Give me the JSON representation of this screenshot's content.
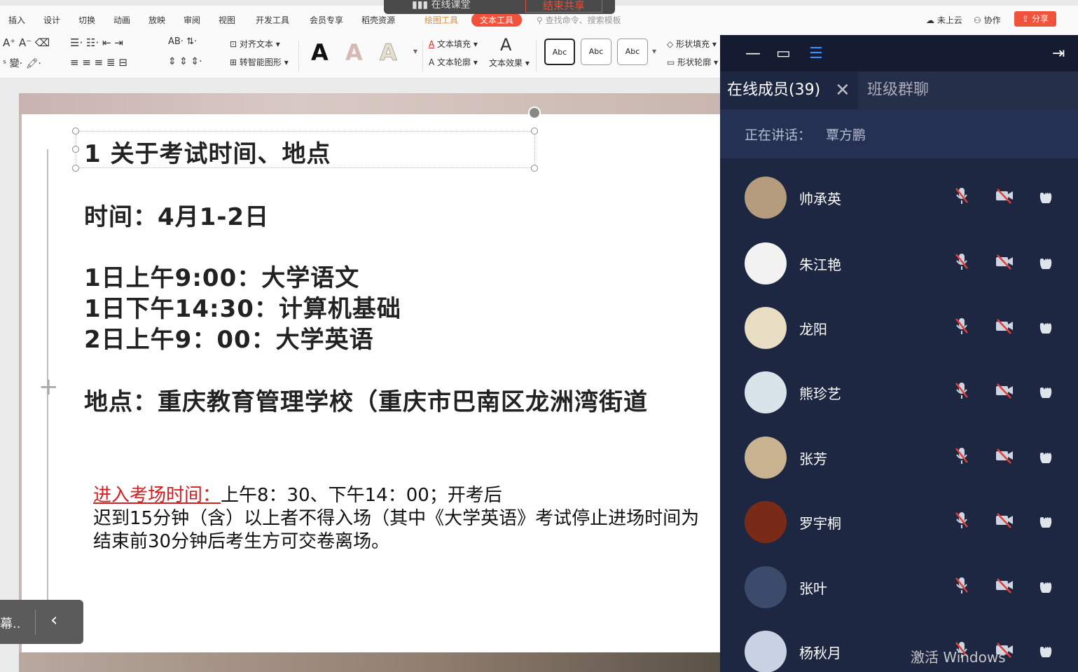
{
  "menubar": {
    "tabs": [
      "插入",
      "设计",
      "切换",
      "动画",
      "放映",
      "审阅",
      "视图",
      "开发工具",
      "会员专享",
      "稻壳资源",
      "绘图工具",
      "文本工具"
    ],
    "search_hint": "查找命令、搜索模板",
    "cloud": "未上云",
    "collab": "协作",
    "share": "分享"
  },
  "share_overlay": {
    "app": "在线课堂",
    "end_button": "结束共享"
  },
  "ribbon": {
    "align_text": "对齐文本",
    "smart_shape": "转智能图形",
    "text_fill": "文本填充",
    "text_outline": "文本轮廓",
    "text_effect": "文本效果",
    "shape_fill": "形状填充",
    "shape_outline": "形状轮廓",
    "style_samples": [
      "Abc",
      "Abc",
      "Abc"
    ],
    "style_letter": "A"
  },
  "slide": {
    "heading": "1 关于考试时间、地点",
    "time_line": "时间：4月1-2日",
    "schedule": [
      "1日上午9:00：大学语文",
      "1日下午14:30：计算机基础",
      "2日上午9：00：大学英语"
    ],
    "location": "地点：重庆教育管理学校（重庆市巴南区龙洲湾街道",
    "entry_label": "进入考场时间：",
    "entry_value": "上午8：30、下午14：00；开考后",
    "late_rule": "迟到15分钟（含）以上者不得入场（其中《大学英语》考试停止进场时间为",
    "leave_rule": "结束前30分钟后考生方可交卷离场。"
  },
  "sidebar_pill": {
    "label": "幕.."
  },
  "panel": {
    "tab_members": "在线成员(39)",
    "tab_chat": "班级群聊",
    "speaking_label": "正在讲话：",
    "speaking_name": "覃方鹏",
    "members": [
      {
        "name": "帅承英",
        "avatar_color": "#b59c7c"
      },
      {
        "name": "朱江艳",
        "avatar_color": "#f2f2f2"
      },
      {
        "name": "龙阳",
        "avatar_color": "#e8dcc2"
      },
      {
        "name": "熊珍艺",
        "avatar_color": "#d9e4ea"
      },
      {
        "name": "张芳",
        "avatar_color": "#c9b28f"
      },
      {
        "name": "罗宇桐",
        "avatar_color": "#7a2b18"
      },
      {
        "name": "张叶",
        "avatar_color": "#3c4a6b"
      },
      {
        "name": "杨秋月",
        "avatar_color": "#c9d2e3"
      }
    ]
  },
  "watermark": "激活 Windows",
  "colors": {
    "panel_bg": "#1d2742",
    "accent_red": "#f0523c",
    "mute_red": "#e0403a"
  }
}
